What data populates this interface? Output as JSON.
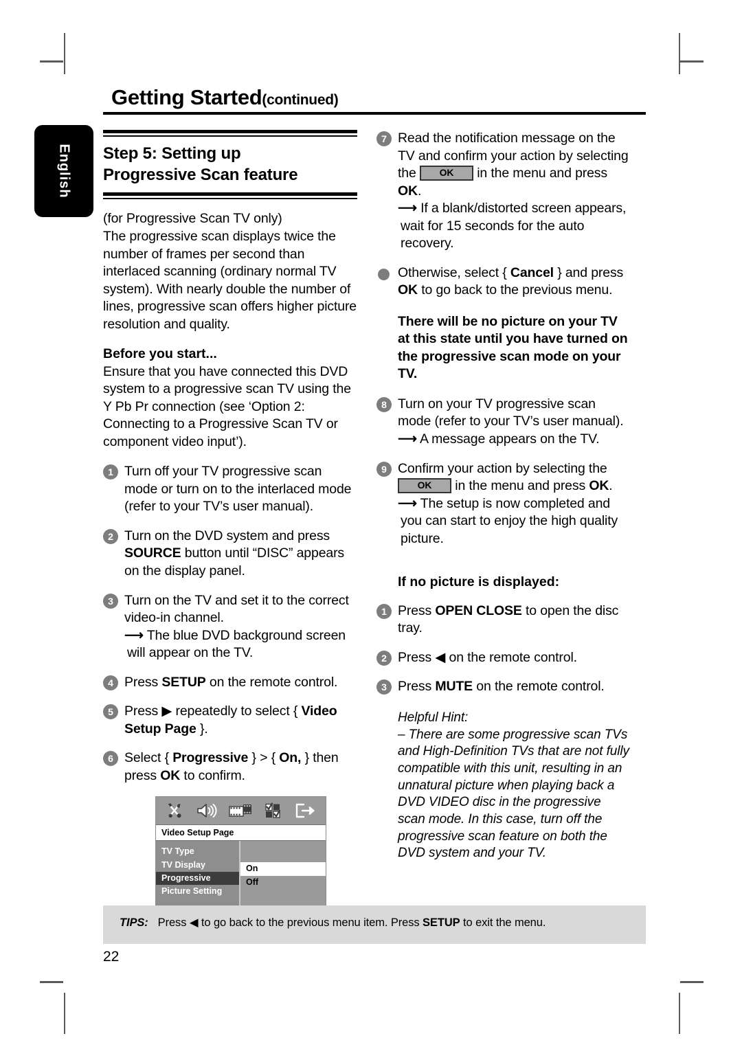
{
  "crop_marks": true,
  "header": {
    "chapter_title": "Getting Started",
    "continued": "(continued)"
  },
  "language_tab": {
    "label": "English"
  },
  "left_column": {
    "step_title_line1": "Step 5:  Setting up",
    "step_title_line2": "Progressive Scan feature",
    "intro_note": "(for Progressive Scan TV only)",
    "intro_body": "The progressive scan displays twice the number of frames per second than interlaced scanning (ordinary normal TV system). With nearly double the number of lines, progressive scan offers higher picture resolution and quality.",
    "before_heading": "Before you start...",
    "before_body": "Ensure that you have connected this DVD system to a progressive scan TV using the Y Pb Pr connection (see ‘Option 2: Connecting to a Progressive Scan TV or component video input’).",
    "steps": [
      {
        "number": "1",
        "text": "Turn off your TV progressive scan mode or turn on to the interlaced mode (refer to your TV’s user manual)."
      },
      {
        "number": "2",
        "text_before": "Turn on the DVD system and press ",
        "bold": "SOURCE",
        "text_after": " button until “DISC” appears on the display panel."
      },
      {
        "number": "3",
        "text": "Turn on the TV and set it to the correct video-in channel.",
        "result": "The blue DVD background screen will appear on the TV."
      },
      {
        "number": "4",
        "text_before": "Press ",
        "bold": "SETUP",
        "text_after": " on the remote control."
      },
      {
        "number": "5",
        "text_before": "Press ",
        "arrow_glyph": "▶",
        "text_mid": " repeatedly to select { ",
        "bold": "Video Setup Page",
        "text_after": " }."
      },
      {
        "number": "6",
        "text_before": "Select { ",
        "bold1": "Progressive",
        "text_mid": " } > { ",
        "bold2": "On,",
        "text_mid2": " } then press ",
        "bold3": "OK",
        "text_after": " to confirm."
      }
    ]
  },
  "osd": {
    "icons": [
      "tools-icon",
      "speaker-icon",
      "film-icon",
      "preferences-icon",
      "exit-icon"
    ],
    "title": "Video Setup Page",
    "menu_items": [
      "TV Type",
      "TV Display",
      "Progressive",
      "Picture Setting"
    ],
    "selected_item": "Progressive",
    "options": [
      "On",
      "Off"
    ],
    "selected_option": "On"
  },
  "right_column": {
    "steps": [
      {
        "number": "7",
        "text_before": "Read the notification message on the TV and confirm your action by selecting the ",
        "chip": "OK",
        "text_mid": " in the menu and press ",
        "bold": "OK",
        "text_after": ".",
        "result": "If a blank/distorted screen appears, wait for 15 seconds for the auto recovery."
      },
      {
        "bullet": true,
        "text_before": "Otherwise, select { ",
        "bold1": "Cancel",
        "text_mid": " } and press ",
        "bold2": "OK",
        "text_after": " to go back to the previous menu."
      }
    ],
    "warning": "There will be no picture on your TV at this state until you have turned on the progressive scan mode on your TV.",
    "step8": {
      "number": "8",
      "text": "Turn on your TV progressive scan mode (refer to your TV’s user manual).",
      "result": "A message appears on the TV."
    },
    "step9": {
      "number": "9",
      "text_before": "Confirm your action by selecting the ",
      "chip": "OK",
      "text_mid": " in the menu and press ",
      "bold": "OK",
      "text_after": ".",
      "result": "The setup is now completed and you can start to enjoy the high quality picture."
    },
    "no_picture_heading": "If no picture is displayed:",
    "no_picture_steps": [
      {
        "number": "1",
        "text_before": "Press ",
        "bold": "OPEN CLOSE",
        "text_after": " to open the disc tray."
      },
      {
        "number": "2",
        "text_before": "Press ",
        "arrow_glyph": "◀",
        "text_after": " on the remote control."
      },
      {
        "number": "3",
        "text_before": "Press ",
        "bold": "MUTE",
        "text_after": " on the remote control."
      }
    ],
    "hint_label": "Helpful Hint:",
    "hint_body": "– There are some progressive scan TVs and High-Definition TVs that are not fully compatible with this unit, resulting in an unnatural picture when playing back a DVD VIDEO disc in the progressive scan mode. In this case, turn off the progressive scan feature on both the DVD system and your TV."
  },
  "footer": {
    "tips_label": "TIPS:",
    "tips_text_1": "Press ",
    "tips_arrow": "◀",
    "tips_text_2": " to go back to the previous menu item.  Press ",
    "tips_bold": "SETUP",
    "tips_text_3": " to exit the menu.",
    "page_number": "22"
  }
}
